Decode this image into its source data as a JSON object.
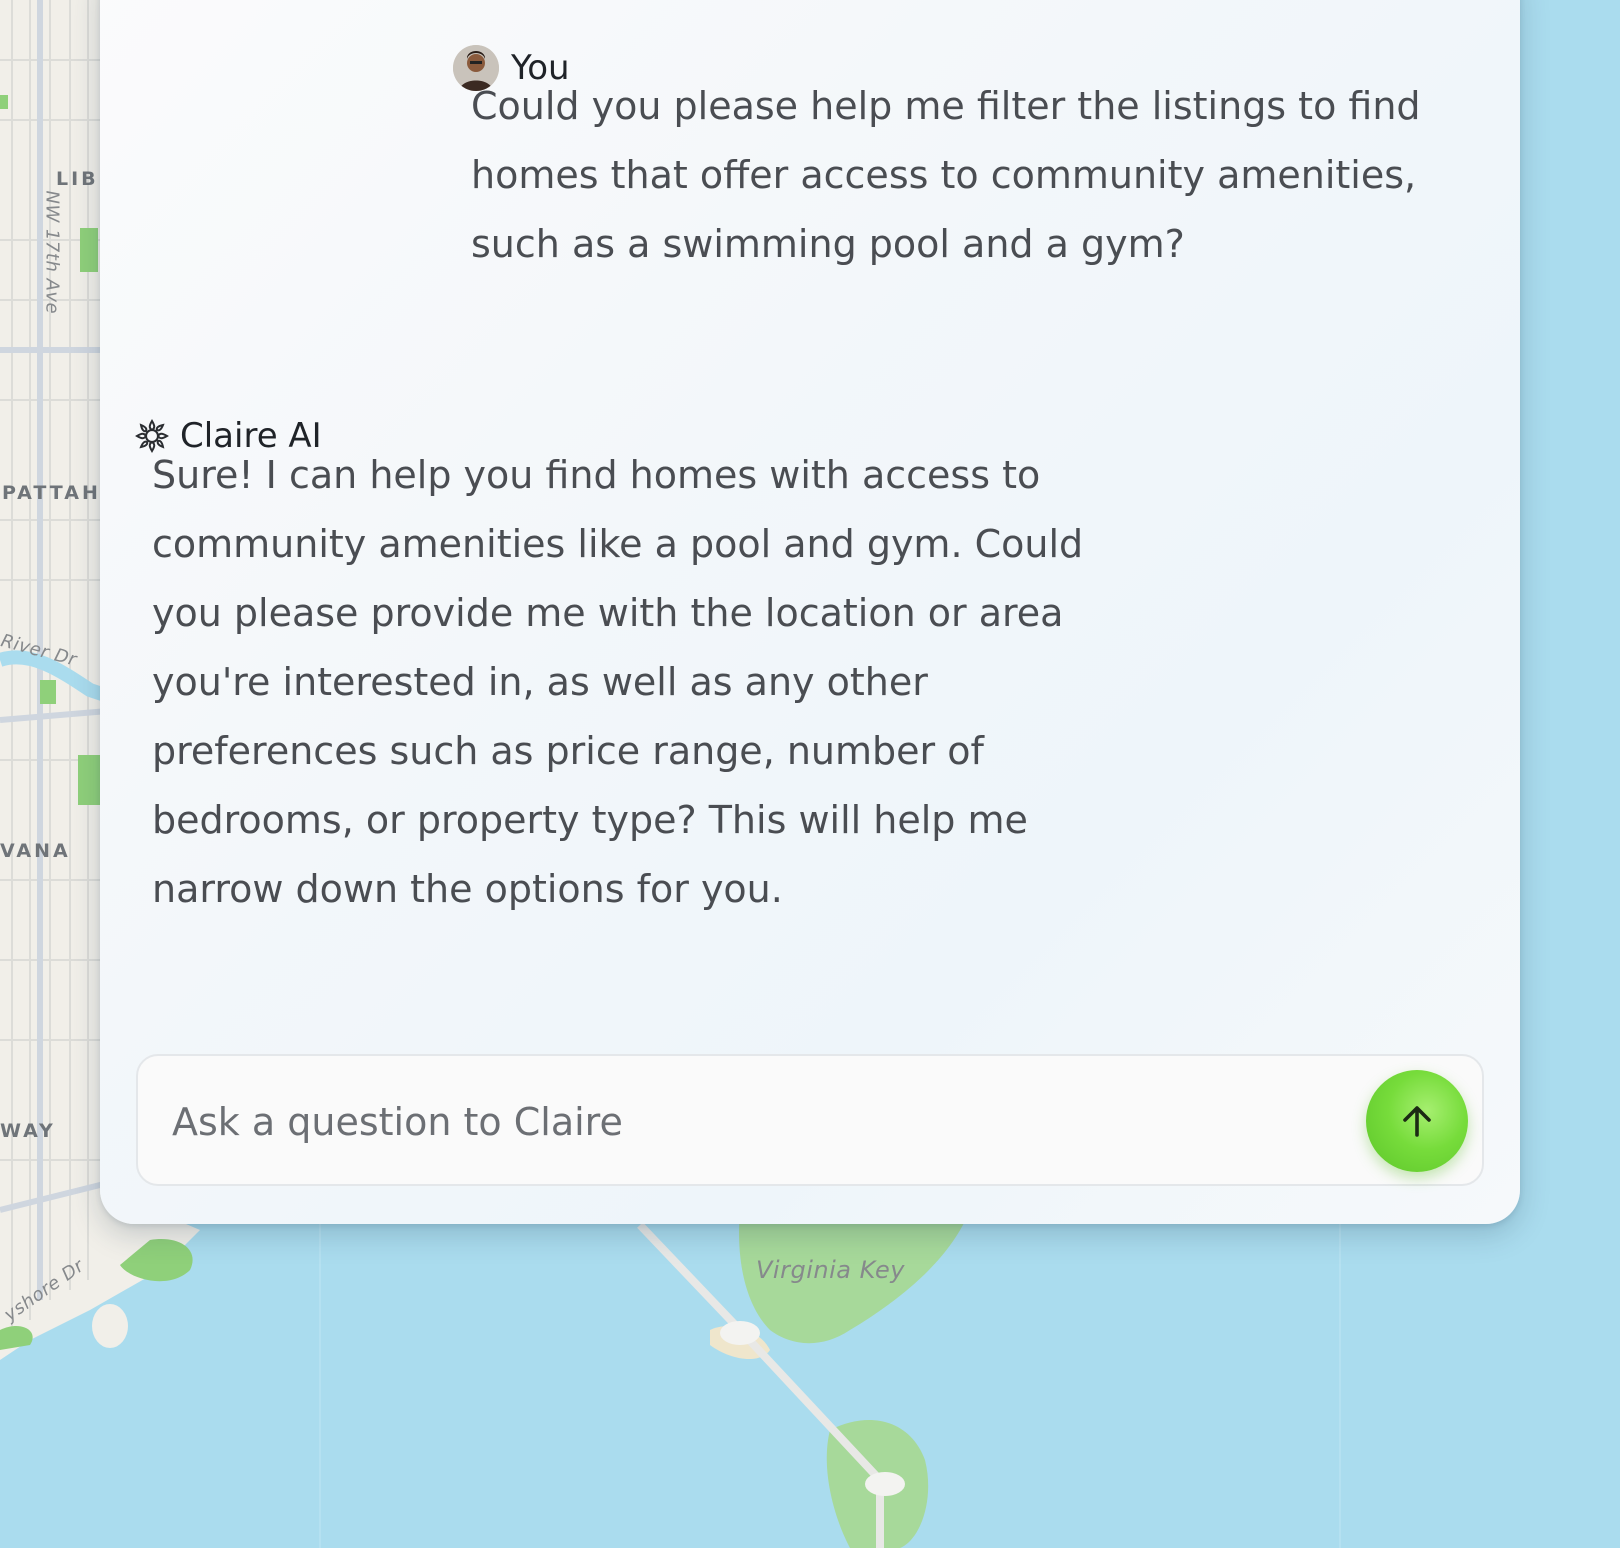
{
  "map": {
    "labels": {
      "liberty": "LIBI",
      "nw_17th_ave": "NW 17th Ave",
      "allapattah": "PATTAH",
      "river_dr": "River Dr",
      "havana": "VANA",
      "way": "WAY",
      "bayshore_dr": "yshore Dr",
      "virginia_key": "Virginia Key"
    }
  },
  "chat": {
    "user": {
      "name": "You",
      "message": "Could you please help me filter the listings to find homes that offer access to community amenities, such as a swimming pool and a gym?"
    },
    "assistant": {
      "name": "Claire AI",
      "icon": "sparkle-gear-icon",
      "message": "Sure! I can help you find homes with access to community amenities like a pool and gym. Could you please provide me with the location or area you're interested in, as well as any other preferences such as price range, number of bedrooms, or property type? This will help me narrow down the options for you."
    }
  },
  "composer": {
    "placeholder": "Ask a question to Claire",
    "value": "",
    "send_icon": "arrow-up-icon",
    "send_color": "#77dc3b"
  },
  "colors": {
    "water": "#aadcee",
    "land": "#f1efe9",
    "park": "#8fd07a",
    "text": "#4a4d52"
  }
}
